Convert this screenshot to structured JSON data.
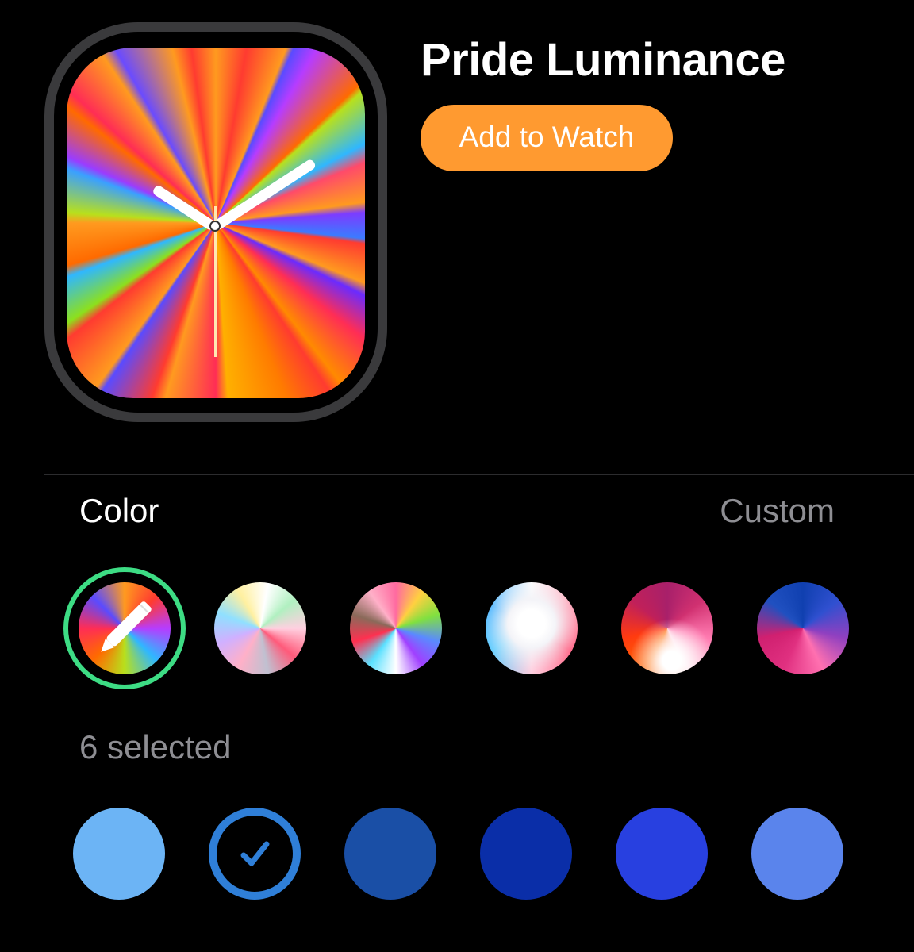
{
  "face": {
    "title": "Pride Luminance",
    "add_button_label": "Add to Watch",
    "preview_icon": "watch-face-preview"
  },
  "color_section": {
    "label": "Color",
    "value": "Custom",
    "swatches": [
      {
        "name": "custom",
        "icon": "pencil-icon",
        "selected": true
      },
      {
        "name": "swatch-2"
      },
      {
        "name": "swatch-3"
      },
      {
        "name": "swatch-4"
      },
      {
        "name": "swatch-5"
      },
      {
        "name": "swatch-6"
      }
    ],
    "accent_color": "#3ddc84"
  },
  "selection": {
    "count_label": "6 selected",
    "dots": [
      {
        "color": "#6cb4f5",
        "checked": false
      },
      {
        "color": "#2f7fd8",
        "checked": true,
        "icon": "checkmark-icon"
      },
      {
        "color": "#1a4fa6",
        "checked": false
      },
      {
        "color": "#0a2ea8",
        "checked": false
      },
      {
        "color": "#2840e0",
        "checked": false
      },
      {
        "color": "#5a84ec",
        "checked": false
      }
    ]
  },
  "colors": {
    "button": "#ff9a30",
    "bezel": "#3a3a3c",
    "secondary_text": "#8e8e93"
  }
}
